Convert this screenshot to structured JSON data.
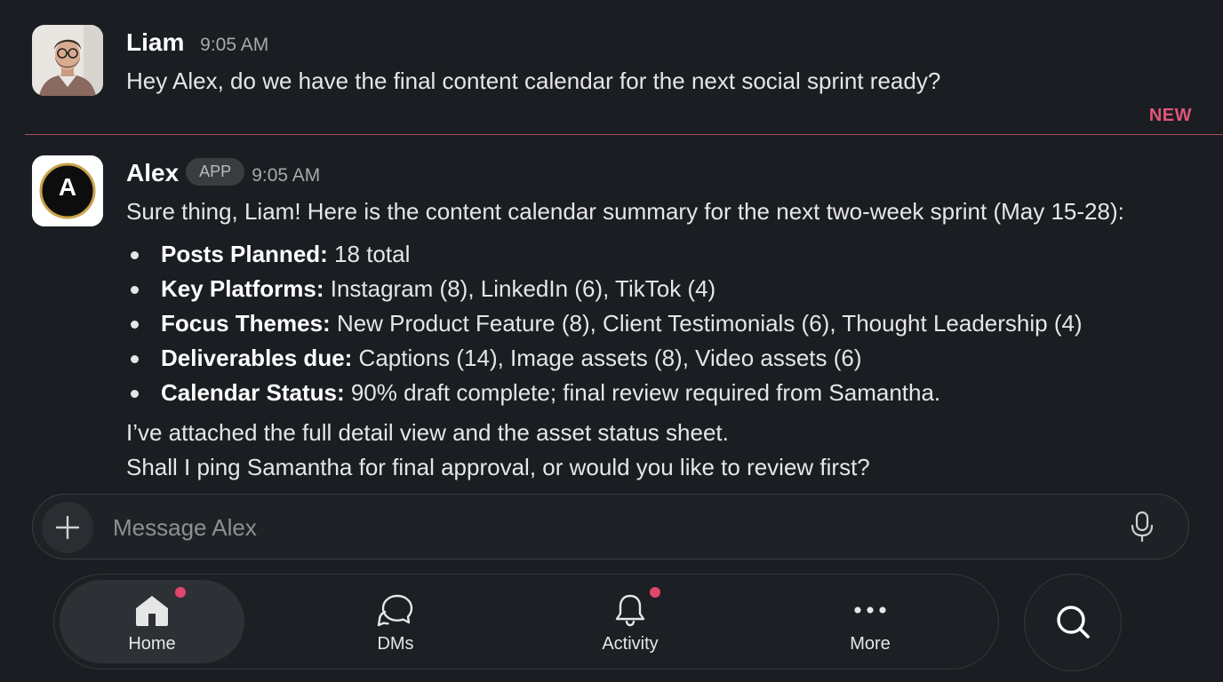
{
  "messages": [
    {
      "sender": "Liam",
      "time": "9:05 AM",
      "text": "Hey Alex, do we have the final content calendar for the next social sprint ready?"
    },
    {
      "sender": "Alex",
      "badge": "APP",
      "time": "9:05 AM",
      "avatar_letter": "A",
      "intro": "Sure thing, Liam! Here is the content calendar summary for the next two-week sprint (May 15-28):",
      "bullets": [
        {
          "label": "Posts Planned:",
          "text": " 18 total"
        },
        {
          "label": "Key Platforms:",
          "text": " Instagram (8), LinkedIn (6), TikTok (4)"
        },
        {
          "label": "Focus Themes:",
          "text": " New Product Feature (8), Client Testimonials (6), Thought Leadership (4)"
        },
        {
          "label": "Deliverables due:",
          "text": " Captions (14), Image assets (8), Video assets (6)"
        },
        {
          "label": "Calendar Status:",
          "text": " 90% draft complete; final review required from Samantha."
        }
      ],
      "outro_1": "I’ve attached the full detail view and the asset status sheet.",
      "outro_2": "Shall I ping Samantha for final approval, or would you like to review first?"
    }
  ],
  "new_divider_label": "NEW",
  "composer": {
    "placeholder": "Message Alex",
    "plus_icon": "plus-icon",
    "mic_icon": "microphone-icon"
  },
  "nav": {
    "items": [
      {
        "label": "Home",
        "icon": "home-icon",
        "active": true,
        "badge": true
      },
      {
        "label": "DMs",
        "icon": "chat-bubbles-icon",
        "active": false,
        "badge": false
      },
      {
        "label": "Activity",
        "icon": "bell-icon",
        "active": false,
        "badge": true
      },
      {
        "label": "More",
        "icon": "more-dots-icon",
        "active": false,
        "badge": false
      }
    ],
    "search_icon": "search-icon"
  },
  "colors": {
    "background": "#1a1d21",
    "new_accent": "#e0557a",
    "badge_dot": "#e0476b"
  }
}
